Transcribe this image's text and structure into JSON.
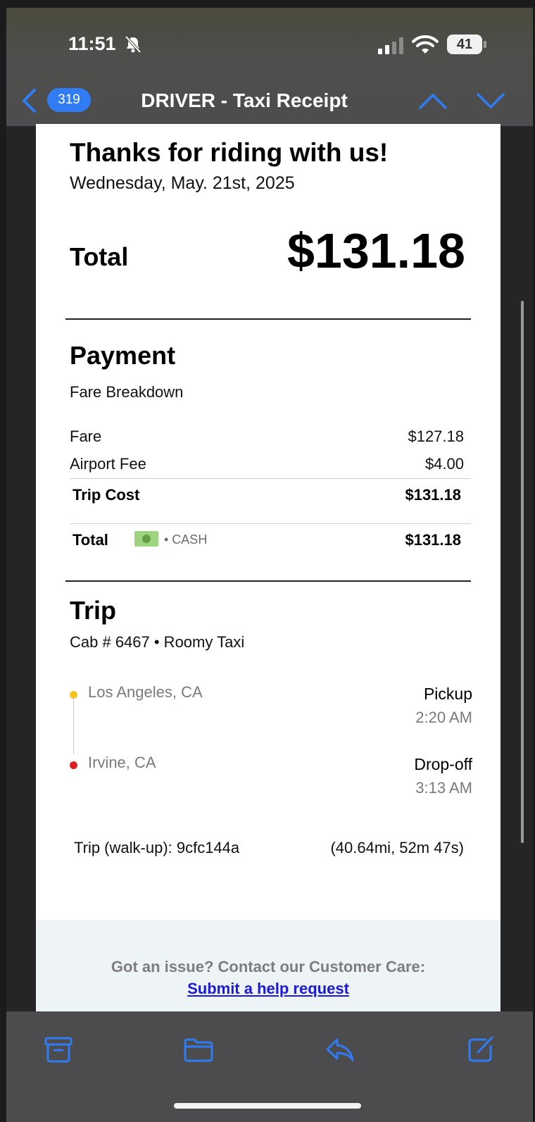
{
  "status_bar": {
    "time": "11:51",
    "battery": "41"
  },
  "nav": {
    "unread_count": "319",
    "title": "DRIVER - Taxi Receipt"
  },
  "receipt": {
    "greeting": "Thanks for riding with us!",
    "date": "Wednesday, May. 21st, 2025",
    "total_label": "Total",
    "total_amount": "$131.18",
    "payment": {
      "heading": "Payment",
      "subheading": "Fare Breakdown",
      "fare_label": "Fare",
      "fare_value": "$127.18",
      "airport_fee_label": "Airport Fee",
      "airport_fee_value": "$4.00",
      "trip_cost_label": "Trip Cost",
      "trip_cost_value": "$131.18",
      "total_label": "Total",
      "method": "• CASH",
      "total_value": "$131.18"
    },
    "trip": {
      "heading": "Trip",
      "cab_info": "Cab # 6467 • Roomy Taxi",
      "pickup_location": "Los Angeles, CA",
      "pickup_label": "Pickup",
      "pickup_time": "2:20 AM",
      "dropoff_location": "Irvine, CA",
      "dropoff_label": "Drop-off",
      "dropoff_time": "3:13 AM",
      "trip_id": "Trip (walk-up): 9cfc144a",
      "trip_stats": "(40.64mi, 52m 47s)"
    },
    "footer": {
      "question": "Got an issue? Contact our Customer Care:",
      "link": "Submit a help request"
    }
  },
  "colors": {
    "accent_blue": "#2f7cf5",
    "pickup_dot": "#f5c518",
    "dropoff_dot": "#e0201f",
    "cash_green": "#9fd47f",
    "link_blue": "#1a1ad8"
  },
  "icons": {
    "toolbar": [
      "archive-icon",
      "folder-icon",
      "reply-icon",
      "compose-icon"
    ]
  }
}
